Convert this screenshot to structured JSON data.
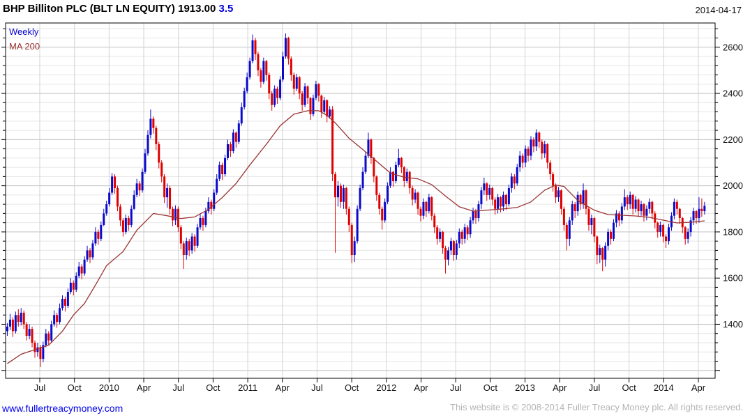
{
  "header": {
    "title_main": "BHP Billiton PLC (BLT LN EQUITY) 1913.00",
    "title_change": "3.5",
    "date": "2014-04-17"
  },
  "legend": {
    "series_label": "Weekly",
    "ma_label": "MA 200"
  },
  "footer": {
    "link": "www.fullertreacymoney.com",
    "copyright": "This website is © 2008-2014 Fuller Treacy Money plc. All rights reserved."
  },
  "chart_data": {
    "type": "candlestick",
    "title": "BHP Billiton PLC (BLT LN EQUITY)",
    "interval": "weekly",
    "last_price": 1913.0,
    "change": 3.5,
    "as_of": "2014-04-17",
    "legend": [
      "Weekly",
      "MA 200"
    ],
    "y_axis": {
      "min": 1166,
      "max": 2705,
      "major_step": 200,
      "minor_step": 40
    },
    "y_ticks": [
      2600,
      2400,
      2200,
      2000,
      1800,
      1600,
      1400
    ],
    "x_labels": [
      "Jul",
      "Oct",
      "2010",
      "Apr",
      "Jul",
      "Oct",
      "2011",
      "Apr",
      "Jul",
      "Oct",
      "2012",
      "Apr",
      "Jul",
      "Oct",
      "2013",
      "Apr",
      "Jul",
      "Oct",
      "2014",
      "Apr"
    ],
    "grid": "on",
    "colors": {
      "up_candle": "#0a0acc",
      "down_candle": "#e00000",
      "ma_line": "#993333",
      "grid_major": "#c2c2c2",
      "grid_minor": "#e6e6e6",
      "grid_vertical": "#d2d2d2",
      "axis": "#000000"
    },
    "first_open": 1370,
    "candles_hlc": [
      [
        1405,
        1350,
        1390
      ],
      [
        1445,
        1375,
        1420
      ],
      [
        1430,
        1345,
        1370
      ],
      [
        1455,
        1360,
        1440
      ],
      [
        1465,
        1390,
        1410
      ],
      [
        1470,
        1395,
        1450
      ],
      [
        1460,
        1380,
        1400
      ],
      [
        1410,
        1330,
        1350
      ],
      [
        1400,
        1335,
        1380
      ],
      [
        1390,
        1300,
        1320
      ],
      [
        1330,
        1255,
        1280
      ],
      [
        1320,
        1260,
        1300
      ],
      [
        1310,
        1215,
        1250
      ],
      [
        1325,
        1235,
        1310
      ],
      [
        1380,
        1300,
        1360
      ],
      [
        1370,
        1310,
        1330
      ],
      [
        1415,
        1320,
        1400
      ],
      [
        1460,
        1390,
        1440
      ],
      [
        1450,
        1385,
        1410
      ],
      [
        1490,
        1400,
        1470
      ],
      [
        1525,
        1460,
        1510
      ],
      [
        1520,
        1455,
        1480
      ],
      [
        1555,
        1470,
        1540
      ],
      [
        1600,
        1530,
        1580
      ],
      [
        1590,
        1525,
        1550
      ],
      [
        1625,
        1540,
        1610
      ],
      [
        1670,
        1600,
        1650
      ],
      [
        1660,
        1595,
        1620
      ],
      [
        1695,
        1610,
        1680
      ],
      [
        1740,
        1670,
        1720
      ],
      [
        1730,
        1665,
        1690
      ],
      [
        1765,
        1680,
        1750
      ],
      [
        1820,
        1740,
        1800
      ],
      [
        1810,
        1745,
        1770
      ],
      [
        1845,
        1760,
        1830
      ],
      [
        1900,
        1825,
        1880
      ],
      [
        1935,
        1870,
        1920
      ],
      [
        1990,
        1910,
        1970
      ],
      [
        2055,
        1960,
        2040
      ],
      [
        2050,
        1965,
        1990
      ],
      [
        2000,
        1890,
        1910
      ],
      [
        1920,
        1825,
        1850
      ],
      [
        1860,
        1780,
        1800
      ],
      [
        1875,
        1790,
        1860
      ],
      [
        1870,
        1805,
        1830
      ],
      [
        1915,
        1820,
        1900
      ],
      [
        1980,
        1895,
        1960
      ],
      [
        2030,
        1950,
        2010
      ],
      [
        2020,
        1955,
        1980
      ],
      [
        2075,
        1970,
        2060
      ],
      [
        2160,
        2050,
        2140
      ],
      [
        2240,
        2130,
        2220
      ],
      [
        2330,
        2205,
        2290
      ],
      [
        2300,
        2225,
        2250
      ],
      [
        2260,
        2155,
        2180
      ],
      [
        2190,
        2075,
        2100
      ],
      [
        2110,
        2015,
        2040
      ],
      [
        2050,
        1925,
        1950
      ],
      [
        2010,
        1905,
        1990
      ],
      [
        2000,
        1875,
        1900
      ],
      [
        1910,
        1825,
        1850
      ],
      [
        1915,
        1830,
        1900
      ],
      [
        1910,
        1800,
        1820
      ],
      [
        1830,
        1725,
        1750
      ],
      [
        1760,
        1640,
        1700
      ],
      [
        1775,
        1680,
        1760
      ],
      [
        1770,
        1695,
        1720
      ],
      [
        1795,
        1705,
        1780
      ],
      [
        1790,
        1715,
        1740
      ],
      [
        1835,
        1730,
        1820
      ],
      [
        1880,
        1810,
        1860
      ],
      [
        1870,
        1805,
        1830
      ],
      [
        1905,
        1820,
        1890
      ],
      [
        1950,
        1880,
        1930
      ],
      [
        1940,
        1875,
        1900
      ],
      [
        1985,
        1890,
        1970
      ],
      [
        2050,
        1960,
        2030
      ],
      [
        2105,
        2020,
        2090
      ],
      [
        2100,
        2025,
        2050
      ],
      [
        2135,
        2040,
        2120
      ],
      [
        2200,
        2110,
        2180
      ],
      [
        2190,
        2125,
        2150
      ],
      [
        2245,
        2140,
        2230
      ],
      [
        2235,
        2165,
        2190
      ],
      [
        2285,
        2180,
        2270
      ],
      [
        2360,
        2260,
        2340
      ],
      [
        2425,
        2330,
        2410
      ],
      [
        2490,
        2400,
        2470
      ],
      [
        2555,
        2460,
        2540
      ],
      [
        2655,
        2530,
        2630
      ],
      [
        2640,
        2545,
        2570
      ],
      [
        2580,
        2475,
        2500
      ],
      [
        2510,
        2425,
        2450
      ],
      [
        2555,
        2440,
        2540
      ],
      [
        2545,
        2455,
        2480
      ],
      [
        2490,
        2375,
        2400
      ],
      [
        2410,
        2325,
        2350
      ],
      [
        2435,
        2340,
        2420
      ],
      [
        2430,
        2355,
        2380
      ],
      [
        2475,
        2370,
        2460
      ],
      [
        2580,
        2450,
        2560
      ],
      [
        2660,
        2550,
        2640
      ],
      [
        2645,
        2525,
        2550
      ],
      [
        2560,
        2455,
        2480
      ],
      [
        2490,
        2395,
        2420
      ],
      [
        2485,
        2410,
        2470
      ],
      [
        2475,
        2375,
        2400
      ],
      [
        2410,
        2325,
        2350
      ],
      [
        2445,
        2340,
        2430
      ],
      [
        2435,
        2355,
        2380
      ],
      [
        2385,
        2285,
        2310
      ],
      [
        2395,
        2300,
        2380
      ],
      [
        2455,
        2370,
        2440
      ],
      [
        2445,
        2365,
        2390
      ],
      [
        2395,
        2295,
        2320
      ],
      [
        2385,
        2310,
        2370
      ],
      [
        2375,
        2275,
        2300
      ],
      [
        2345,
        2290,
        2330
      ],
      [
        2345,
        2020,
        2050
      ],
      [
        2060,
        1710,
        1950
      ],
      [
        2020,
        1910,
        2000
      ],
      [
        2010,
        1905,
        1930
      ],
      [
        2005,
        1900,
        1990
      ],
      [
        1995,
        1875,
        1900
      ],
      [
        1910,
        1800,
        1830
      ],
      [
        1840,
        1665,
        1700
      ],
      [
        1780,
        1670,
        1760
      ],
      [
        1915,
        1750,
        1900
      ],
      [
        2005,
        1890,
        1990
      ],
      [
        2080,
        1980,
        2060
      ],
      [
        2145,
        2050,
        2130
      ],
      [
        2230,
        2120,
        2200
      ],
      [
        2205,
        2095,
        2120
      ],
      [
        2125,
        2015,
        2040
      ],
      [
        2045,
        1935,
        1960
      ],
      [
        1970,
        1875,
        1900
      ],
      [
        1910,
        1810,
        1850
      ],
      [
        1945,
        1840,
        1930
      ],
      [
        2015,
        1920,
        2000
      ],
      [
        2080,
        1990,
        2060
      ],
      [
        2065,
        1995,
        2020
      ],
      [
        2105,
        2010,
        2090
      ],
      [
        2160,
        2080,
        2120
      ],
      [
        2125,
        2055,
        2080
      ],
      [
        2085,
        1995,
        2020
      ],
      [
        2075,
        2010,
        2060
      ],
      [
        2065,
        1965,
        1990
      ],
      [
        2000,
        1915,
        1940
      ],
      [
        1985,
        1925,
        1970
      ],
      [
        1975,
        1875,
        1900
      ],
      [
        1910,
        1845,
        1870
      ],
      [
        1945,
        1855,
        1930
      ],
      [
        1935,
        1865,
        1890
      ],
      [
        1965,
        1880,
        1950
      ],
      [
        1955,
        1850,
        1870
      ],
      [
        1880,
        1795,
        1820
      ],
      [
        1830,
        1745,
        1770
      ],
      [
        1815,
        1755,
        1800
      ],
      [
        1805,
        1705,
        1730
      ],
      [
        1740,
        1620,
        1680
      ],
      [
        1735,
        1655,
        1720
      ],
      [
        1775,
        1700,
        1760
      ],
      [
        1765,
        1675,
        1700
      ],
      [
        1765,
        1680,
        1750
      ],
      [
        1815,
        1730,
        1800
      ],
      [
        1810,
        1745,
        1770
      ],
      [
        1835,
        1750,
        1820
      ],
      [
        1830,
        1765,
        1790
      ],
      [
        1865,
        1775,
        1850
      ],
      [
        1905,
        1835,
        1890
      ],
      [
        1900,
        1835,
        1860
      ],
      [
        1935,
        1845,
        1920
      ],
      [
        1995,
        1900,
        1980
      ],
      [
        2035,
        1960,
        2010
      ],
      [
        2015,
        1935,
        1960
      ],
      [
        2005,
        1940,
        1990
      ],
      [
        1995,
        1915,
        1940
      ],
      [
        1950,
        1875,
        1900
      ],
      [
        1965,
        1880,
        1950
      ],
      [
        1955,
        1885,
        1910
      ],
      [
        1975,
        1890,
        1960
      ],
      [
        1965,
        1895,
        1920
      ],
      [
        2005,
        1910,
        1990
      ],
      [
        2055,
        1970,
        2040
      ],
      [
        2050,
        1985,
        2010
      ],
      [
        2095,
        2000,
        2080
      ],
      [
        2150,
        2060,
        2130
      ],
      [
        2140,
        2075,
        2100
      ],
      [
        2175,
        2080,
        2160
      ],
      [
        2170,
        2105,
        2130
      ],
      [
        2215,
        2110,
        2200
      ],
      [
        2210,
        2145,
        2170
      ],
      [
        2245,
        2150,
        2230
      ],
      [
        2235,
        2165,
        2190
      ],
      [
        2200,
        2115,
        2140
      ],
      [
        2195,
        2120,
        2180
      ],
      [
        2185,
        2075,
        2100
      ],
      [
        2110,
        2025,
        2050
      ],
      [
        2060,
        1975,
        2000
      ],
      [
        2010,
        1925,
        1950
      ],
      [
        1995,
        1930,
        1980
      ],
      [
        1985,
        1875,
        1900
      ],
      [
        1910,
        1805,
        1830
      ],
      [
        1840,
        1720,
        1770
      ],
      [
        1865,
        1740,
        1850
      ],
      [
        1935,
        1830,
        1920
      ],
      [
        1930,
        1860,
        1890
      ],
      [
        1975,
        1870,
        1960
      ],
      [
        1965,
        1895,
        1920
      ],
      [
        2010,
        1900,
        1980
      ],
      [
        1985,
        1875,
        1900
      ],
      [
        1910,
        1805,
        1830
      ],
      [
        1875,
        1790,
        1860
      ],
      [
        1865,
        1755,
        1780
      ],
      [
        1785,
        1660,
        1700
      ],
      [
        1745,
        1665,
        1730
      ],
      [
        1735,
        1630,
        1680
      ],
      [
        1755,
        1650,
        1740
      ],
      [
        1815,
        1720,
        1800
      ],
      [
        1810,
        1745,
        1770
      ],
      [
        1855,
        1760,
        1840
      ],
      [
        1895,
        1820,
        1880
      ],
      [
        1890,
        1825,
        1850
      ],
      [
        1925,
        1835,
        1910
      ],
      [
        1985,
        1895,
        1950
      ],
      [
        1960,
        1895,
        1920
      ],
      [
        1975,
        1900,
        1960
      ],
      [
        1965,
        1875,
        1900
      ],
      [
        1955,
        1885,
        1940
      ],
      [
        1945,
        1865,
        1890
      ],
      [
        1935,
        1870,
        1920
      ],
      [
        1925,
        1845,
        1870
      ],
      [
        1915,
        1850,
        1900
      ],
      [
        1945,
        1880,
        1930
      ],
      [
        1935,
        1855,
        1880
      ],
      [
        1890,
        1815,
        1840
      ],
      [
        1845,
        1775,
        1800
      ],
      [
        1845,
        1780,
        1830
      ],
      [
        1835,
        1755,
        1780
      ],
      [
        1790,
        1730,
        1760
      ],
      [
        1835,
        1745,
        1820
      ],
      [
        1885,
        1805,
        1870
      ],
      [
        1945,
        1855,
        1930
      ],
      [
        1940,
        1875,
        1900
      ],
      [
        1905,
        1835,
        1860
      ],
      [
        1865,
        1795,
        1820
      ],
      [
        1825,
        1745,
        1770
      ],
      [
        1815,
        1750,
        1800
      ],
      [
        1865,
        1780,
        1850
      ],
      [
        1905,
        1830,
        1890
      ],
      [
        1895,
        1835,
        1860
      ],
      [
        1950,
        1840,
        1900
      ],
      [
        1945,
        1865,
        1890
      ],
      [
        1930,
        1875,
        1913
      ]
    ],
    "ma200_points": [
      [
        0,
        1230
      ],
      [
        5,
        1270
      ],
      [
        10,
        1290
      ],
      [
        15,
        1310
      ],
      [
        20,
        1370
      ],
      [
        24,
        1440
      ],
      [
        28,
        1490
      ],
      [
        32,
        1570
      ],
      [
        36,
        1654
      ],
      [
        42,
        1715
      ],
      [
        47,
        1808
      ],
      [
        53,
        1880
      ],
      [
        58,
        1870
      ],
      [
        63,
        1858
      ],
      [
        68,
        1865
      ],
      [
        73,
        1898
      ],
      [
        78,
        1949
      ],
      [
        83,
        2010
      ],
      [
        88,
        2090
      ],
      [
        94,
        2180
      ],
      [
        99,
        2260
      ],
      [
        104,
        2310
      ],
      [
        109,
        2325
      ],
      [
        113,
        2325
      ],
      [
        116,
        2305
      ],
      [
        119,
        2272
      ],
      [
        124,
        2206
      ],
      [
        129,
        2157
      ],
      [
        134,
        2106
      ],
      [
        139,
        2055
      ],
      [
        144,
        2037
      ],
      [
        149,
        2030
      ],
      [
        154,
        2005
      ],
      [
        159,
        1955
      ],
      [
        164,
        1909
      ],
      [
        169,
        1890
      ],
      [
        175,
        1895
      ],
      [
        180,
        1900
      ],
      [
        185,
        1906
      ],
      [
        190,
        1930
      ],
      [
        195,
        1981
      ],
      [
        199,
        2003
      ],
      [
        202,
        1997
      ],
      [
        207,
        1936
      ],
      [
        213,
        1894
      ],
      [
        218,
        1875
      ],
      [
        223,
        1872
      ],
      [
        228,
        1869
      ],
      [
        233,
        1863
      ],
      [
        238,
        1851
      ],
      [
        243,
        1839
      ],
      [
        248,
        1842
      ],
      [
        253,
        1848
      ]
    ]
  }
}
